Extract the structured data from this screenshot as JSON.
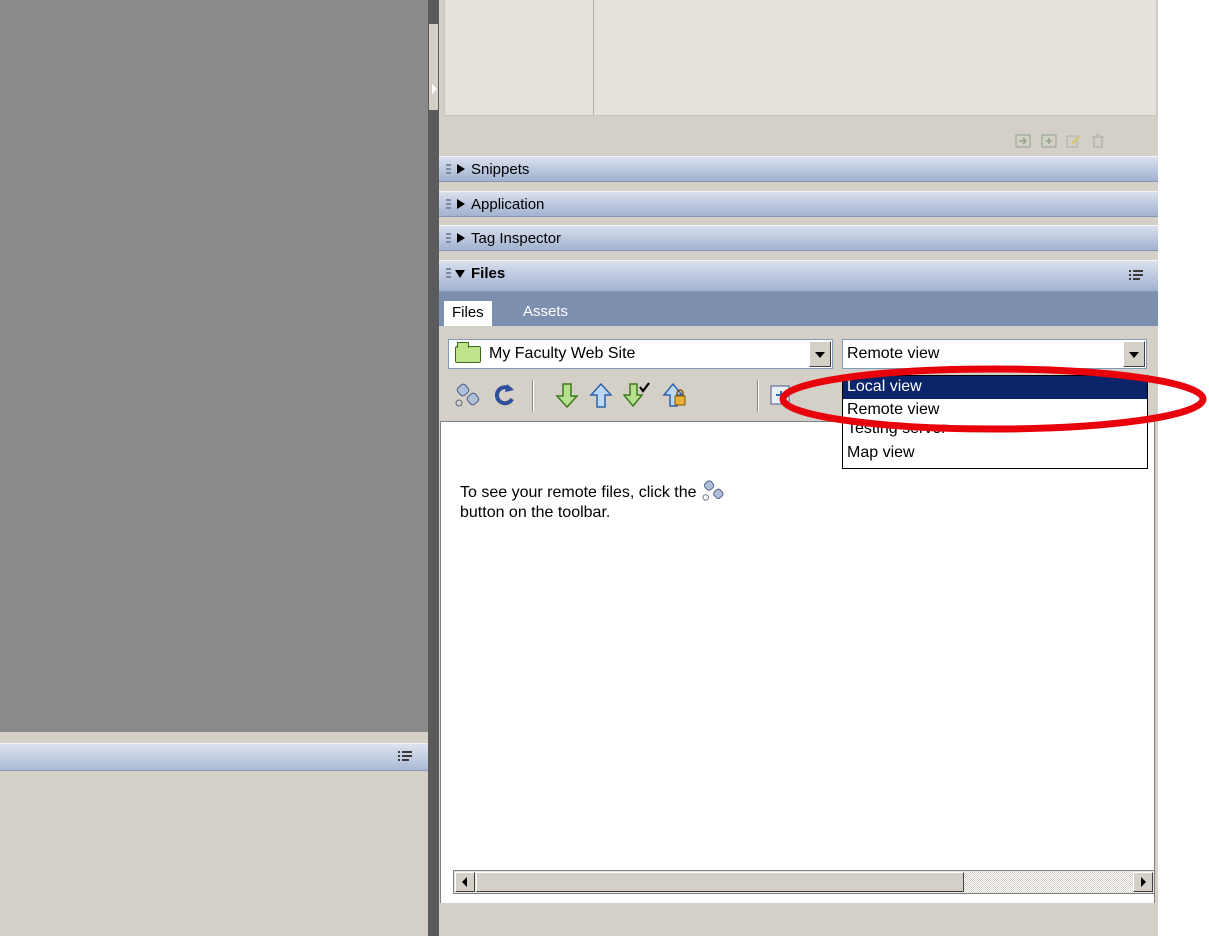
{
  "panels": {
    "snippets": "Snippets",
    "application": "Application",
    "tag_inspector": "Tag Inspector",
    "files": "Files"
  },
  "files_panel": {
    "tabs": [
      "Files",
      "Assets"
    ],
    "active_tab": "Files",
    "site_selector": {
      "value": "My Faculty Web Site",
      "icon": "folder-icon"
    },
    "view_selector": {
      "value": "Remote view",
      "options": [
        "Local view",
        "Remote view",
        "Testing server",
        "Map view"
      ],
      "highlighted": "Local view"
    },
    "toolbar": [
      "connect-icon",
      "refresh-icon",
      "get-files-icon",
      "put-files-icon",
      "check-out-icon",
      "check-in-icon",
      "expand-icon"
    ],
    "message_line1": "To see your remote files, click the",
    "message_line2": "button on the toolbar."
  },
  "annotation": {
    "color": "#e8000b",
    "shape": "ellipse"
  }
}
